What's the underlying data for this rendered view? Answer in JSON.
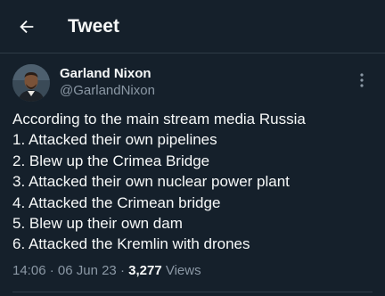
{
  "header": {
    "title": "Tweet",
    "back_icon": "arrow-left-icon"
  },
  "author": {
    "display_name": "Garland Nixon",
    "handle": "@GarlandNixon",
    "more_icon": "more-vertical-icon"
  },
  "tweet": {
    "lines": [
      "According to the main stream media Russia",
      "1. Attacked their own pipelines",
      "2. Blew up the Crimea Bridge",
      "3. Attacked their own nuclear power plant",
      "4. Attacked the Crimean bridge",
      "5. Blew up their own dam",
      "6. Attacked the Kremlin with drones"
    ],
    "time": "14:06",
    "separator": " · ",
    "date": "06 Jun 23",
    "views_count": "3,277",
    "views_label": "Views"
  },
  "colors": {
    "background": "#15202b",
    "text_primary": "#f7f9f9",
    "text_secondary": "#8b98a5",
    "divider": "#2f3b47"
  }
}
